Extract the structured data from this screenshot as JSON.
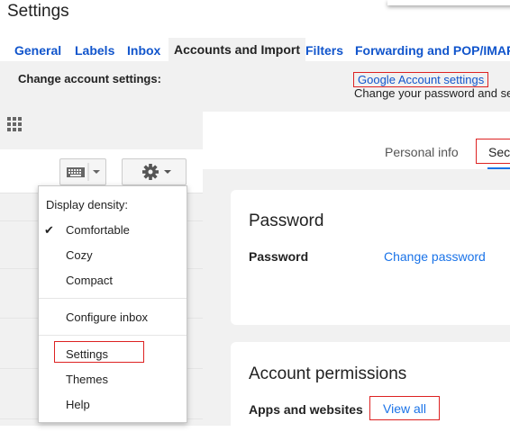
{
  "page": {
    "title": "Settings"
  },
  "tabs": [
    {
      "label": "General"
    },
    {
      "label": "Labels"
    },
    {
      "label": "Inbox"
    },
    {
      "label": "Accounts and Import",
      "active": true
    },
    {
      "label": "Filters"
    },
    {
      "label": "Forwarding and POP/IMAP"
    }
  ],
  "account_settings": {
    "label": "Change account settings:",
    "link": "Google Account settings",
    "subtext": "Change your password and se"
  },
  "settings_menu": {
    "heading": "Display density:",
    "items": [
      "Comfortable",
      "Cozy",
      "Compact"
    ],
    "checked": "Comfortable",
    "configure": "Configure inbox",
    "settings": "Settings",
    "themes": "Themes",
    "help": "Help"
  },
  "account_page": {
    "tab_personal": "Personal info",
    "tab_security": "Secu",
    "password_card": {
      "title": "Password",
      "row_label": "Password",
      "action": "Change password"
    },
    "permissions_card": {
      "title": "Account permissions",
      "row_label": "Apps and websites",
      "action": "View all"
    }
  },
  "colors": {
    "link": "#1155cc",
    "highlight": "#dd2222",
    "accent": "#1a73e8"
  },
  "icons": [
    "apps-grid-icon",
    "keyboard-icon",
    "gear-icon",
    "chevron-down-icon",
    "check-icon"
  ]
}
